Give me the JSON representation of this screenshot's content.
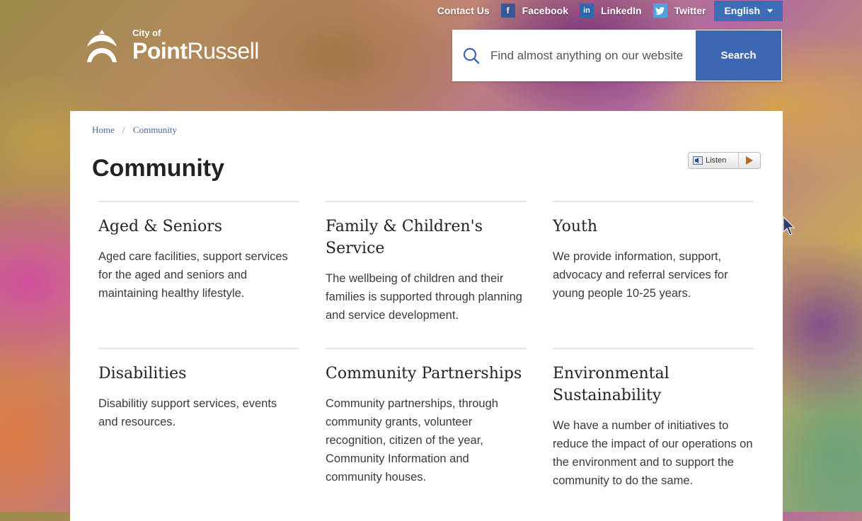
{
  "topbar": {
    "contact": "Contact Us",
    "facebook": "Facebook",
    "linkedin": "LinkedIn",
    "twitter": "Twitter",
    "language": "English"
  },
  "logo": {
    "city_of": "City of",
    "name_bold": "Point",
    "name_light": "Russell"
  },
  "search": {
    "placeholder": "Find almost anything on our website",
    "button": "Search"
  },
  "breadcrumb": {
    "home": "Home",
    "separator": "/",
    "current": "Community"
  },
  "page_title": "Community",
  "listen_label": "Listen",
  "cards": [
    {
      "title": "Aged & Seniors",
      "text": "Aged care facilities, support services for the aged and seniors and maintaining healthy lifestyle."
    },
    {
      "title": "Family & Children's Service",
      "text": "The wellbeing of children and their families is supported through planning and service development."
    },
    {
      "title": "Youth",
      "text": "We provide information, support, advocacy and referral services for young people 10-25 years."
    },
    {
      "title": "Disabilities",
      "text": "Disabilitiy support services, events and resources."
    },
    {
      "title": "Community Partnerships",
      "text": "Community partnerships, through community grants, volunteer recognition, citizen of the year, Community Information and community houses."
    },
    {
      "title": "Environmental Sustainability",
      "text": "We have a number of initiatives to reduce the impact of our operations on the environment and to support the community to do the same."
    }
  ],
  "colors": {
    "accent_blue": "#3d66b3",
    "text_dark": "#222222"
  }
}
